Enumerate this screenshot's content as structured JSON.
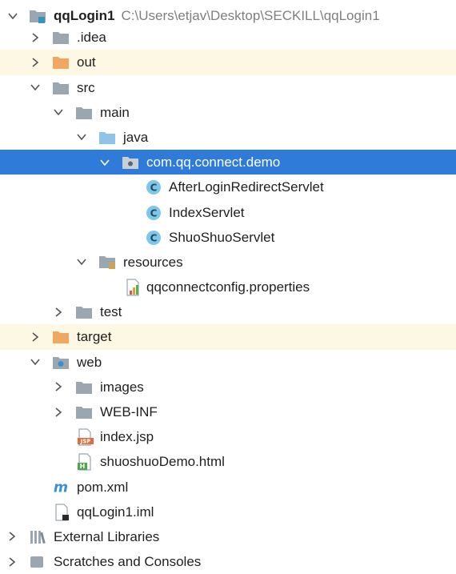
{
  "project_tree": {
    "root": {
      "name": "qqLogin1",
      "path": "C:\\Users\\etjav\\Desktop\\SECKILL\\qqLogin1"
    },
    "idea": ".idea",
    "out": "out",
    "src": "src",
    "main": "main",
    "java": "java",
    "package": "com.qq.connect.demo",
    "classes": [
      "AfterLoginRedirectServlet",
      "IndexServlet",
      "ShuoShuoServlet"
    ],
    "resources": "resources",
    "properties_file": "qqconnectconfig.properties",
    "test": "test",
    "target": "target",
    "web": "web",
    "images": "images",
    "web_inf": "WEB-INF",
    "index_jsp": "index.jsp",
    "html_file": "shuoshuoDemo.html",
    "pom": "pom.xml",
    "iml": "qqLogin1.iml",
    "external_libraries": "External Libraries",
    "scratches": "Scratches and Consoles"
  },
  "icons": {
    "folder_color": "#9aa7b0",
    "excluded_folder_color": "#f0a860",
    "source_folder_color": "#8fc3e8",
    "class_icon_color": "#7ec7e8",
    "selection_color": "#2f7bd9",
    "excluded_row_color": "#fdf8e3"
  }
}
